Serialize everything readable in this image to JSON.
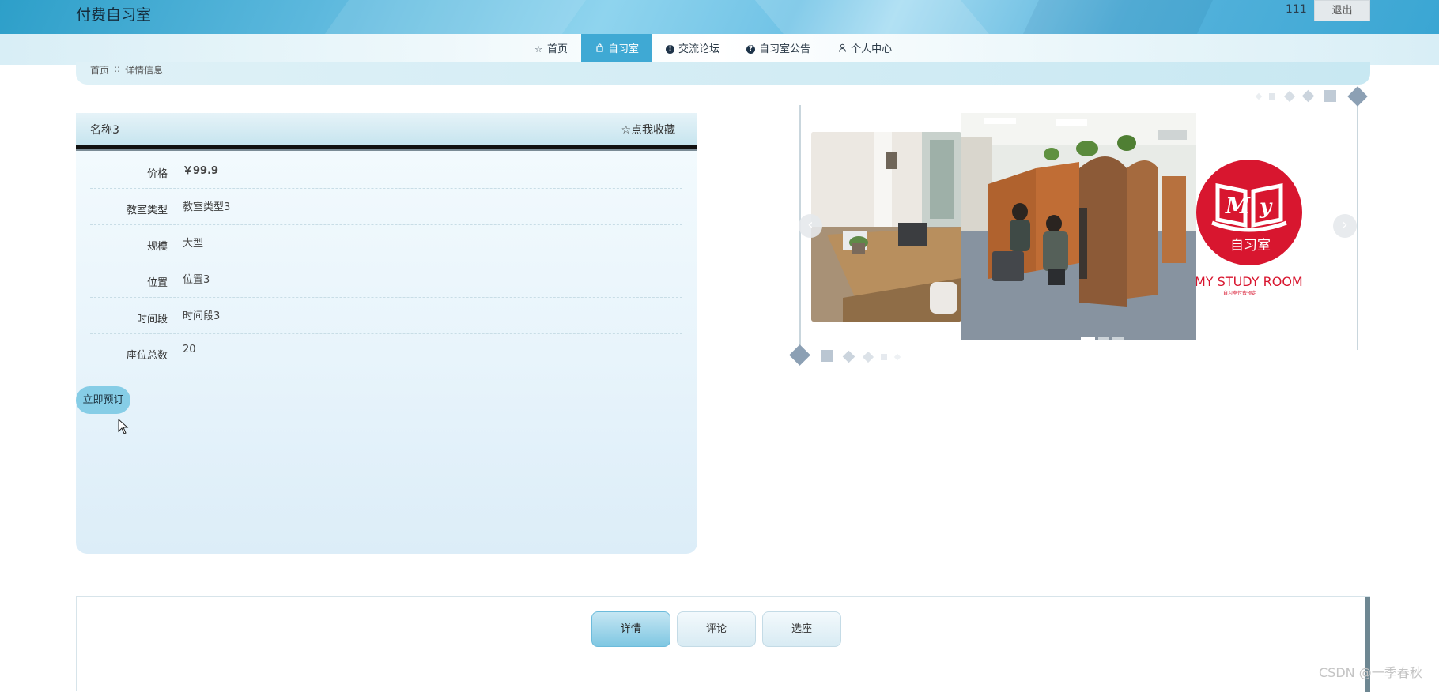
{
  "header": {
    "site_title": "付费自习室",
    "username": "111",
    "logout_label": "退出"
  },
  "nav": {
    "items": [
      {
        "label": "首页",
        "icon": "star-outline-icon"
      },
      {
        "label": "自习室",
        "icon": "bag-icon",
        "active": true
      },
      {
        "label": "交流论坛",
        "icon": "info-circle-icon"
      },
      {
        "label": "自习室公告",
        "icon": "question-circle-icon"
      },
      {
        "label": "个人中心",
        "icon": "user-icon"
      }
    ]
  },
  "breadcrumb": {
    "home": "首页",
    "separator": "::",
    "current": "详情信息"
  },
  "detail": {
    "name": "名称3",
    "favorite_label": "☆点我收藏",
    "fields": [
      {
        "label": "价格",
        "value": "￥99.9"
      },
      {
        "label": "教室类型",
        "value": "教室类型3"
      },
      {
        "label": "规模",
        "value": "大型"
      },
      {
        "label": "位置",
        "value": "位置3"
      },
      {
        "label": "时间段",
        "value": "时间段3"
      },
      {
        "label": "座位总数",
        "value": "20"
      }
    ],
    "book_button": "立即预订"
  },
  "carousel": {
    "logo_letters": "My",
    "logo_title": "自习室",
    "logo_caption": "MY STUDY ROOM",
    "logo_subcaption": "自习室付费预定",
    "prev_icon": "chevron-left-icon",
    "next_icon": "chevron-right-icon",
    "slide_count": 3,
    "active_slide": 1
  },
  "tabs": [
    {
      "label": "详情",
      "active": true
    },
    {
      "label": "评论",
      "active": false
    },
    {
      "label": "选座",
      "active": false
    }
  ],
  "watermark": "CSDN @一季春秋",
  "colors": {
    "accent": "#3fa9d4",
    "button": "#86cde6",
    "logo_red": "#d8162f"
  }
}
